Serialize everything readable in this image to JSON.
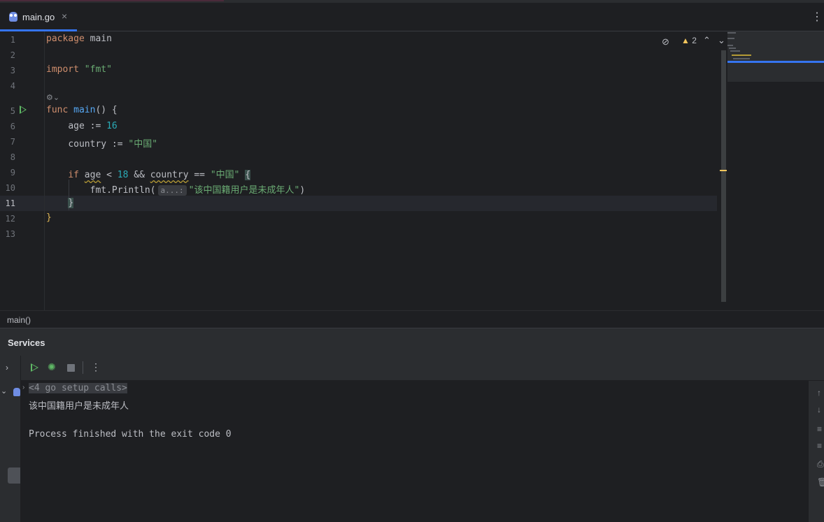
{
  "tab": {
    "filename": "main.go",
    "close": "×",
    "more": "⋮"
  },
  "editor": {
    "line_numbers": [
      "1",
      "2",
      "3",
      "4",
      "5",
      "6",
      "7",
      "8",
      "9",
      "10",
      "11",
      "12",
      "13"
    ],
    "code": {
      "l1_kw": "package",
      "l1_name": "main",
      "l3_kw": "import",
      "l3_str": "\"fmt\"",
      "l5_kw": "func",
      "l5_fn": "main",
      "l5_rest": "() {",
      "l6_var": "age",
      "l6_op": " := ",
      "l6_num": "16",
      "l7_var": "country",
      "l7_op": " := ",
      "l7_str": "\"中国\"",
      "l9_kw": "if",
      "l9_var1": "age",
      "l9_op1": " < ",
      "l9_num": "18",
      "l9_op2": " && ",
      "l9_var2": "country",
      "l9_op3": " == ",
      "l9_str": "\"中国\"",
      "l9_brace": "{",
      "l10_call": "fmt.Println(",
      "l10_hint": "a...:",
      "l10_str": "\"该中国籍用户是未成年人\"",
      "l10_close": ")",
      "l11_brace": "}",
      "l12_brace": "}"
    },
    "warnings_count": "2",
    "breadcrumb": "main()"
  },
  "services": {
    "title": "Services",
    "console": {
      "setup_calls": "<4 go setup calls>",
      "output_line": "该中国籍用户是未成年人",
      "process_finished": "Process finished with the exit code 0"
    }
  }
}
